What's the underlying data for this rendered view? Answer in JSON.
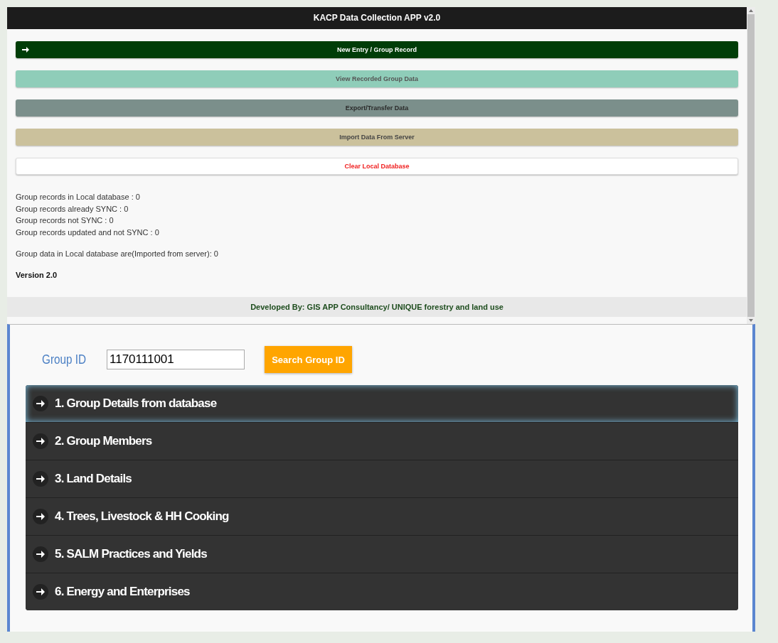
{
  "app": {
    "title": "KACP Data Collection APP v2.0",
    "buttons": [
      {
        "label": "New Entry / Group Record",
        "kind": "primary"
      },
      {
        "label": "View Recorded Group Data",
        "kind": "teal"
      },
      {
        "label": "Export/Transfer Data",
        "kind": "grey"
      },
      {
        "label": "Import Data From Server",
        "kind": "tan"
      },
      {
        "label": "Clear Local Database",
        "kind": "danger"
      }
    ],
    "stats": [
      "Group records in Local database : 0",
      "Group records already SYNC : 0",
      "Group records not SYNC : 0",
      "Group records updated and not SYNC : 0"
    ],
    "imported": "Group data in Local database are(Imported from server): 0",
    "version": "Version 2.0",
    "footer": "Developed By: GIS APP Consultancy/ UNIQUE forestry and land use"
  },
  "search": {
    "label": "Group ID",
    "value": "1170111001",
    "button": "Search Group ID"
  },
  "sections": [
    {
      "label": "1. Group Details from database",
      "selected": true
    },
    {
      "label": "2. Group Members",
      "selected": false
    },
    {
      "label": "3. Land Details",
      "selected": false
    },
    {
      "label": "4. Trees, Livestock & HH Cooking",
      "selected": false
    },
    {
      "label": "5. SALM Practices and Yields",
      "selected": false
    },
    {
      "label": "6. Energy and Enterprises",
      "selected": false
    }
  ]
}
